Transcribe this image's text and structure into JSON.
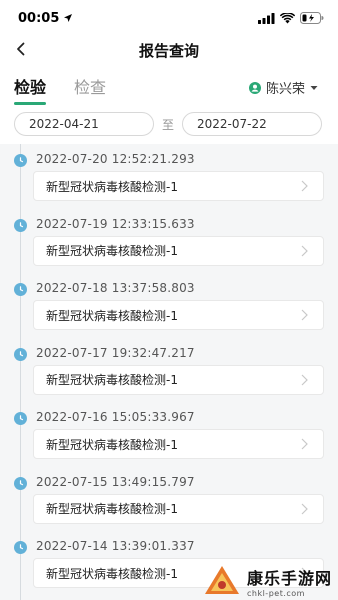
{
  "status": {
    "time": "00:05"
  },
  "nav": {
    "title": "报告查询"
  },
  "tabs": [
    {
      "label": "检验",
      "active": true
    },
    {
      "label": "检查",
      "active": false
    }
  ],
  "user": {
    "name": "陈兴荣"
  },
  "date_range": {
    "start": "2022-04-21",
    "separator": "至",
    "end": "2022-07-22"
  },
  "colors": {
    "accent": "#2aa876",
    "timeline_dot": "#62b1d8",
    "list_bg": "#f5f6f7"
  },
  "records": [
    {
      "time": "2022-07-20 12:52:21.293",
      "name": "新型冠状病毒核酸检测-1"
    },
    {
      "time": "2022-07-19 12:33:15.633",
      "name": "新型冠状病毒核酸检测-1"
    },
    {
      "time": "2022-07-18 13:37:58.803",
      "name": "新型冠状病毒核酸检测-1"
    },
    {
      "time": "2022-07-17 19:32:47.217",
      "name": "新型冠状病毒核酸检测-1"
    },
    {
      "time": "2022-07-16 15:05:33.967",
      "name": "新型冠状病毒核酸检测-1"
    },
    {
      "time": "2022-07-15 13:49:15.797",
      "name": "新型冠状病毒核酸检测-1"
    },
    {
      "time": "2022-07-14 13:39:01.337",
      "name": "新型冠状病毒核酸检测-1"
    }
  ],
  "watermark": {
    "main": "康乐手游网",
    "sub": "chkl-pet.com"
  }
}
